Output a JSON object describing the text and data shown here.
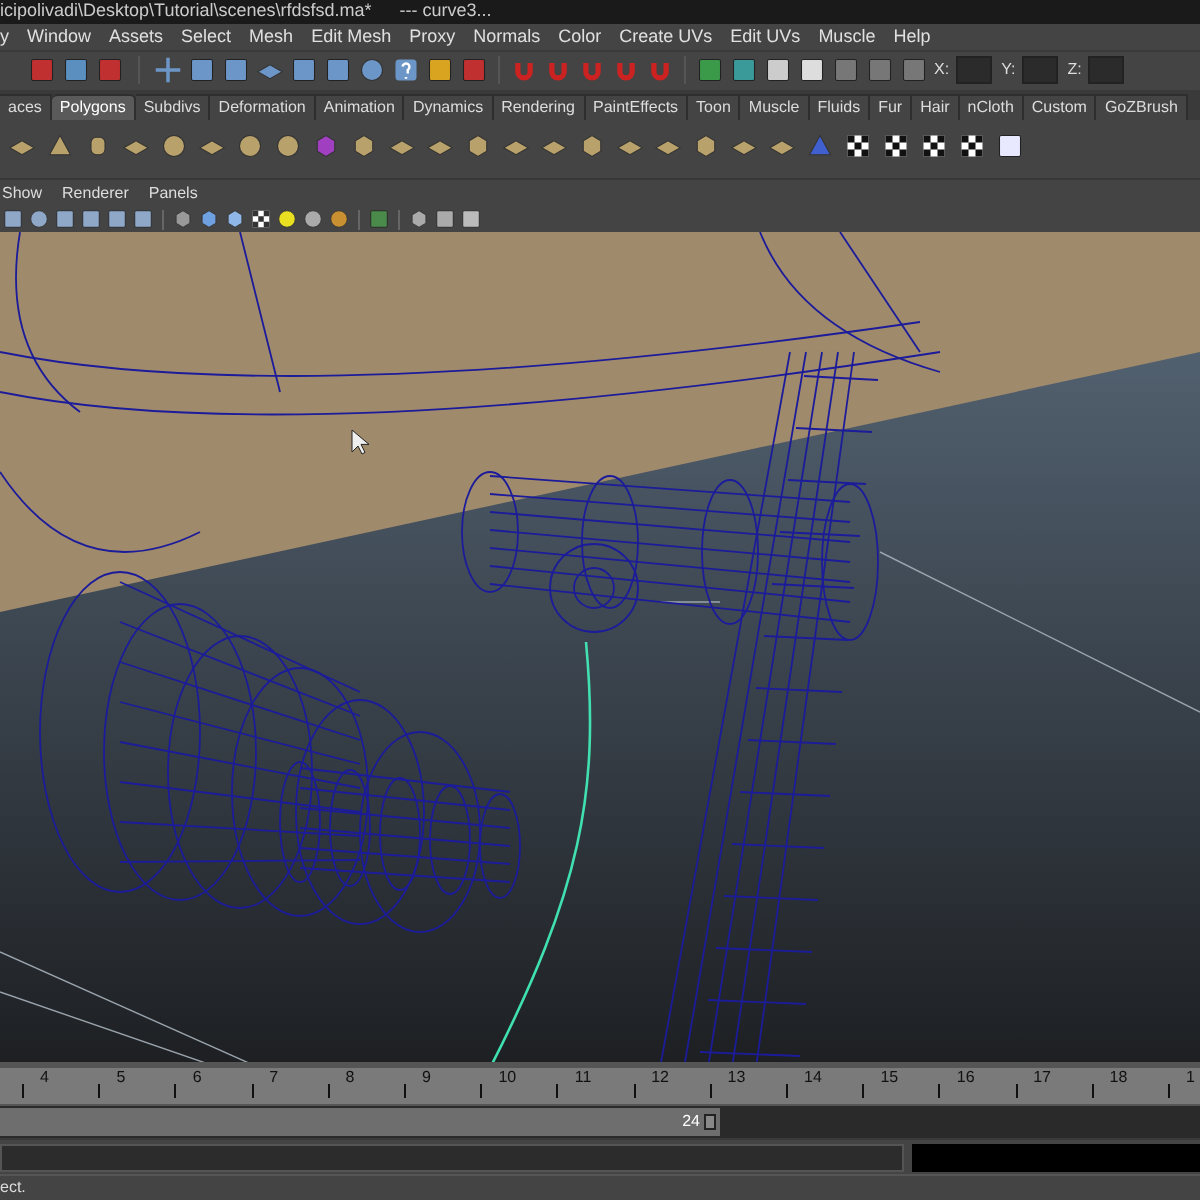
{
  "window": {
    "title": "icipolivadi\\Desktop\\Tutorial\\scenes\\rfdsfsd.ma*",
    "title_suffix": "---   curve3..."
  },
  "menu_bar": [
    "y",
    "Window",
    "Assets",
    "Select",
    "Mesh",
    "Edit Mesh",
    "Proxy",
    "Normals",
    "Color",
    "Create UVs",
    "Edit UVs",
    "Muscle",
    "Help"
  ],
  "status_line": {
    "fields": [
      {
        "label": "X:"
      },
      {
        "label": "Y:"
      },
      {
        "label": "Z:"
      }
    ]
  },
  "shelf_tabs": [
    {
      "label": "aces",
      "selected": false
    },
    {
      "label": "Polygons",
      "selected": true
    },
    {
      "label": "Subdivs",
      "selected": false
    },
    {
      "label": "Deformation",
      "selected": false
    },
    {
      "label": "Animation",
      "selected": false
    },
    {
      "label": "Dynamics",
      "selected": false
    },
    {
      "label": "Rendering",
      "selected": false
    },
    {
      "label": "PaintEffects",
      "selected": false
    },
    {
      "label": "Toon",
      "selected": false
    },
    {
      "label": "Muscle",
      "selected": false
    },
    {
      "label": "Fluids",
      "selected": false
    },
    {
      "label": "Fur",
      "selected": false
    },
    {
      "label": "Hair",
      "selected": false
    },
    {
      "label": "nCloth",
      "selected": false
    },
    {
      "label": "Custom",
      "selected": false
    },
    {
      "label": "GoZBrush",
      "selected": false
    }
  ],
  "panel_menu": [
    "Show",
    "Renderer",
    "Panels"
  ],
  "time_slider": {
    "ticks": [
      "4",
      "5",
      "6",
      "7",
      "8",
      "9",
      "10",
      "11",
      "12",
      "13",
      "14",
      "15",
      "16",
      "17",
      "18",
      "1"
    ]
  },
  "range_slider": {
    "end": "24",
    "level": 0.6
  },
  "help_line": "ect."
}
